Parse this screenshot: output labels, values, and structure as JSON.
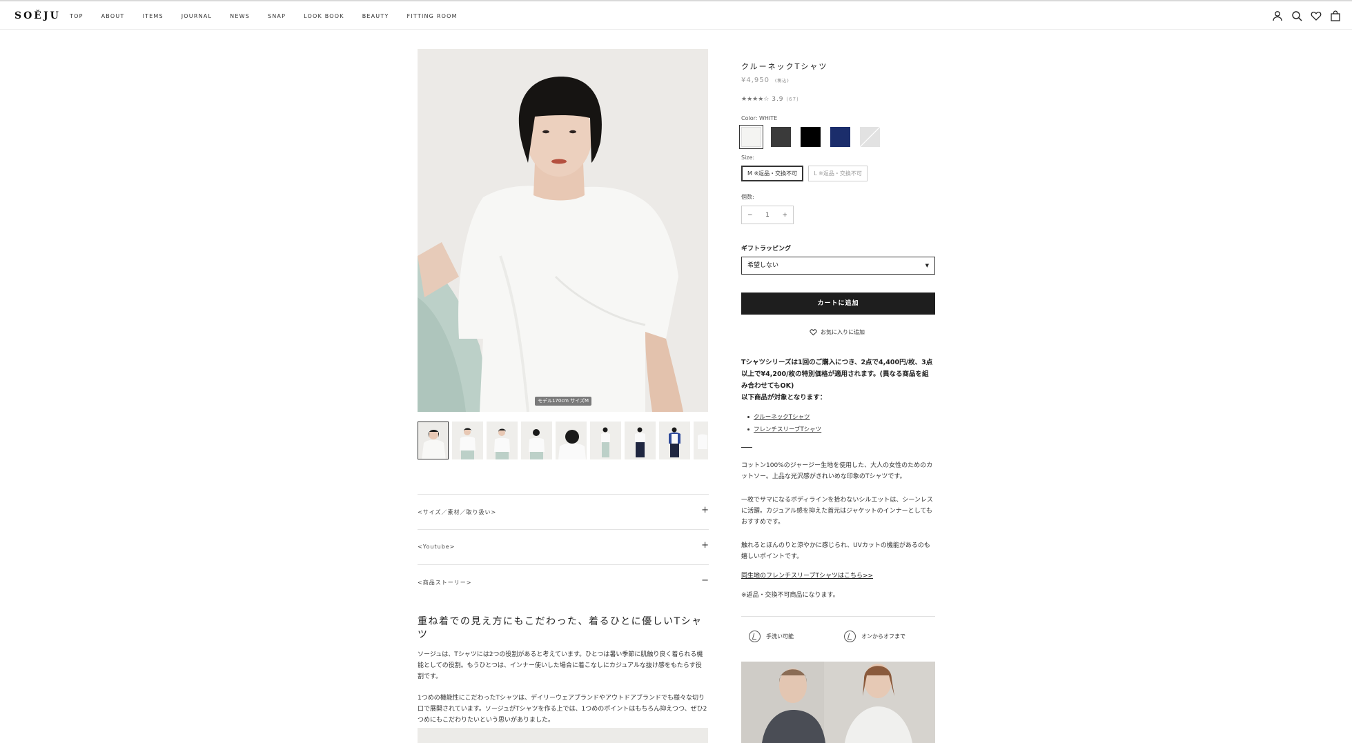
{
  "header": {
    "logo": "SOĚJU",
    "nav": [
      "TOP",
      "ABOUT",
      "ITEMS",
      "JOURNAL",
      "NEWS",
      "SNAP",
      "LOOK BOOK",
      "BEAUTY",
      "FITTING ROOM"
    ],
    "icons": [
      "account-icon",
      "search-icon",
      "heart-icon",
      "bag-icon"
    ]
  },
  "gallery": {
    "caption": "モデル170cm サイズM",
    "thumbnail_count": 9,
    "selected_index": 0
  },
  "accordions": [
    {
      "label": "<サイズ／素材／取り扱い>",
      "sign": "+"
    },
    {
      "label": "<Youtube>",
      "sign": "+"
    },
    {
      "label": "<商品ストーリー>",
      "sign": "−"
    }
  ],
  "story": {
    "title": "重ね着での見え方にもこだわった、着るひとに優しいTシャツ",
    "p1": "ソージュは、Tシャツには2つの役割があると考えています。ひとつは暑い季節に肌触り良く着られる機能としての役割。もうひとつは、インナー使いした場合に着こなしにカジュアルな抜け感をもたらす役割です。",
    "p2": "1つめの機能性にこだわったTシャツは、デイリーウェアブランドやアウトドアブランドでも様々な切り口で展開されています。ソージュがTシャツを作る上では、1つめのポイントはもちろん抑えつつ、ぜひ2つめにもこだわりたいという思いがありました。"
  },
  "product": {
    "title": "クルーネックTシャツ",
    "price": "¥4,950",
    "tax_note": "(税込)",
    "stars": "★★★★☆",
    "rating": "3.9",
    "review_count": "(67)",
    "color_label": "Color: WHITE",
    "colors": [
      {
        "name": "white",
        "hex": "#f4f4f2",
        "selected": true
      },
      {
        "name": "charcoal",
        "hex": "#3a3a3a",
        "selected": false
      },
      {
        "name": "black",
        "hex": "#000000",
        "selected": false
      },
      {
        "name": "navy",
        "hex": "#1b2d6b",
        "selected": false
      },
      {
        "name": "light-gray",
        "hex": "#e2e2e2",
        "selected": false
      }
    ],
    "size_label": "Size:",
    "sizes": [
      {
        "label": "M ※返品・交換不可",
        "selected": true
      },
      {
        "label": "L ※返品・交換不可",
        "selected": false
      }
    ],
    "qty_label": "個数:",
    "qty_value": "1",
    "qty_minus": "−",
    "qty_plus": "+",
    "gift_label": "ギフトラッピング",
    "gift_value": "希望しない",
    "cart_button": "カートに追加",
    "fav_button": "お気に入りに追加"
  },
  "promo": {
    "text": "Tシャツシリーズは1回のご購入につき、2点で4,400円/枚、3点以上で¥4,200/枚の特別価格が適用されます。(異なる商品を組み合わせてもOK)",
    "text2": "以下商品が対象となります：",
    "items": [
      "クルーネックTシャツ",
      "フレンチスリーブTシャツ"
    ]
  },
  "description": {
    "p1": "コットン100%のジャージー生地を使用した、大人の女性のためのカットソー。上品な光沢感がきれいめな印象のTシャツです。",
    "p2": "一枚でサマになるボディラインを拾わないシルエットは、シーンレスに活躍。カジュアル感を抑えた首元はジャケットのインナーとしてもおすすめです。",
    "p3": "触れるとほんのりと涼やかに感じられ、UVカットの機能があるのも嬉しいポイントです。",
    "link": "同生地のフレンチスリーブTシャツはこちら>>",
    "note": "※返品・交換不可商品になります。"
  },
  "features": [
    {
      "label": "手洗い可能",
      "icon": "hand-wash-icon"
    },
    {
      "label": "オンからオフまで",
      "icon": "on-off-icon"
    }
  ]
}
